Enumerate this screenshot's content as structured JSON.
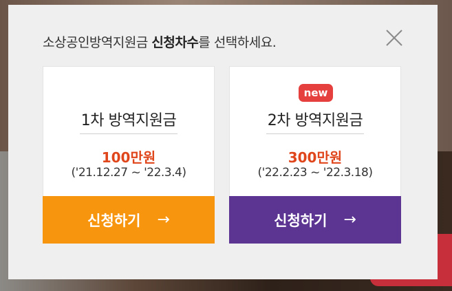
{
  "modal": {
    "title_prefix": "소상공인방역지원금 ",
    "title_bold": "신청차수",
    "title_suffix": "를 선택하세요.",
    "close_label": "×"
  },
  "cards": [
    {
      "badge": "",
      "title": "1차 방역지원금",
      "amount": "100만원",
      "period": "('21.12.27 ~ '22.3.4)",
      "button_label": "신청하기",
      "button_color": "#f7950f"
    },
    {
      "badge": "new",
      "title": "2차 방역지원금",
      "amount": "300만원",
      "period": "('22.2.23 ~ '22.3.18)",
      "button_label": "신청하기",
      "button_color": "#5c3592"
    }
  ],
  "icons": {
    "close": "close-icon",
    "arrow": "arrow-right-icon"
  },
  "arrow_glyph": "→",
  "colors": {
    "amount": "#e0461c",
    "badge": "#e5403d",
    "modal_bg": "#efefef"
  }
}
